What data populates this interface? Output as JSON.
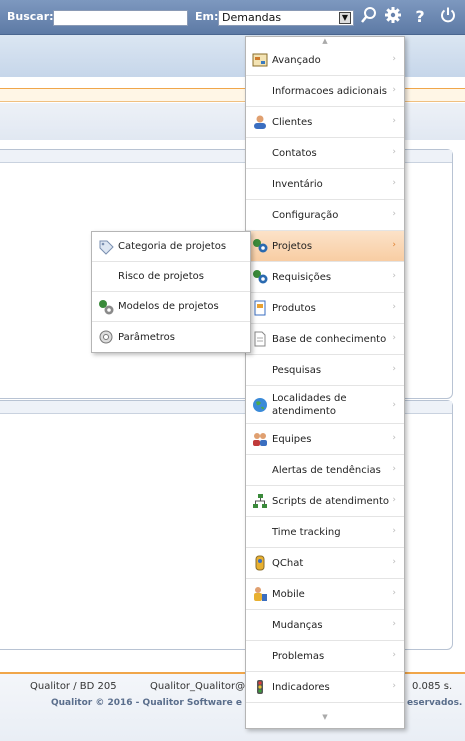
{
  "topbar": {
    "search_label": "Buscar:",
    "search_value": "",
    "scope_label": "Em:",
    "scope_value": "Demandas",
    "icons": [
      "search-icon",
      "gear-icon",
      "help-icon",
      "power-icon"
    ],
    "help_glyph": "?"
  },
  "main_menu": {
    "items": [
      {
        "label": "Avançado",
        "icon": "advanced-icon"
      },
      {
        "label": "Informacoes adicionais",
        "icon": ""
      },
      {
        "label": "Clientes",
        "icon": "clients-icon"
      },
      {
        "label": "Contatos",
        "icon": ""
      },
      {
        "label": "Inventário",
        "icon": ""
      },
      {
        "label": "Configuração",
        "icon": ""
      },
      {
        "label": "Projetos",
        "icon": "projects-icon",
        "active": true
      },
      {
        "label": "Requisições",
        "icon": "requests-icon"
      },
      {
        "label": "Produtos",
        "icon": "products-icon"
      },
      {
        "label": "Base de conhecimento",
        "icon": "knowledge-base-icon"
      },
      {
        "label": "Pesquisas",
        "icon": ""
      },
      {
        "label": "Localidades de atendimento",
        "icon": "globe-icon"
      },
      {
        "label": "Equipes",
        "icon": "teams-icon"
      },
      {
        "label": "Alertas de tendências",
        "icon": ""
      },
      {
        "label": "Scripts de atendimento",
        "icon": "scripts-icon"
      },
      {
        "label": "Time tracking",
        "icon": ""
      },
      {
        "label": "QChat",
        "icon": "chat-icon"
      },
      {
        "label": "Mobile",
        "icon": "mobile-icon"
      },
      {
        "label": "Mudanças",
        "icon": ""
      },
      {
        "label": "Problemas",
        "icon": ""
      },
      {
        "label": "Indicadores",
        "icon": "indicators-icon"
      }
    ]
  },
  "sub_menu": {
    "items": [
      {
        "label": "Categoria de projetos",
        "icon": "tag-icon"
      },
      {
        "label": "Risco de projetos",
        "icon": ""
      },
      {
        "label": "Modelos de projetos",
        "icon": "template-icon"
      },
      {
        "label": "Parâmetros",
        "icon": "settings-icon"
      }
    ]
  },
  "footer": {
    "db_info": "Qualitor / BD 205",
    "user_info": "Qualitor_Qualitor@",
    "time": "0.085 s.",
    "copyright_left": "Qualitor © 2016 - Qualitor Software e S",
    "copyright_right": "eservados."
  }
}
